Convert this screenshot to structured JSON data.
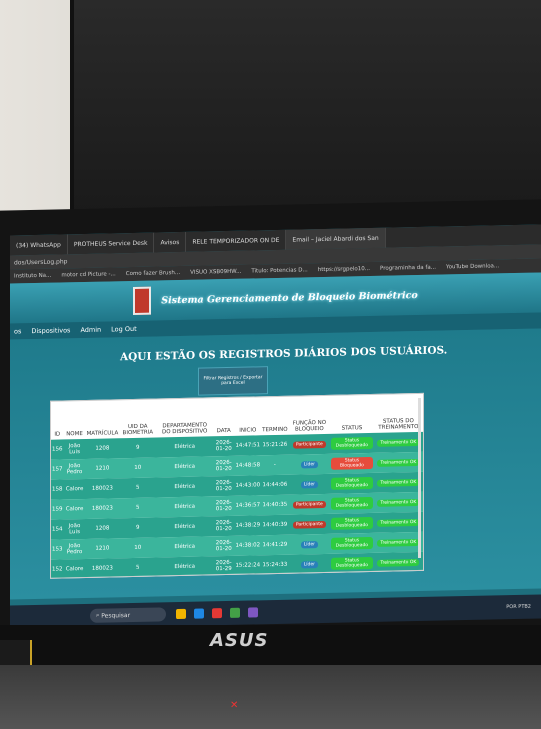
{
  "browser": {
    "tabs": [
      "(34) WhatsApp",
      "PROTHEUS Service Desk",
      "Avisos",
      "RELE TEMPORIZADOR ON DE",
      "Email – Jaciel Abardi dos San"
    ],
    "url": "dos/UsersLog.php",
    "bookmarks": [
      "Instituto Na...",
      "motor cd Picture -...",
      "Como fazer Brush...",
      "VISUO XSB09HW...",
      "Titulo: Potencias D...",
      "https://srgpelo10...",
      "Programinha da fa...",
      "YouTube Downloa..."
    ]
  },
  "app": {
    "title": "Sistema Gerenciamento de Bloqueio Biométrico",
    "nav": [
      "os",
      "Dispositivos",
      "Admin",
      "Log Out"
    ],
    "heading": "AQUI ESTÃO OS REGISTROS DIÁRIOS DOS USUÁRIOS.",
    "filter_button": "Filtrar Registros / Exportar para Excel",
    "columns": [
      "ID",
      "NOME",
      "MATRÍCULA",
      "UID DA BIOMETRIA",
      "DEPARTAMENTO DO DISPOSITIVO",
      "DATA",
      "INICIO",
      "TERMINO",
      "FUNÇÃO NO BLOQUEIO",
      "STATUS",
      "STATUS DO TREINAMENTO"
    ],
    "rows": [
      [
        "156",
        "João Luis",
        "1208",
        "9",
        "Elétrica",
        "2026-01-20",
        "14:47:51",
        "15:21:26",
        "Participante",
        "Status Desbloqueado",
        "Treinamento OK"
      ],
      [
        "157",
        "João Pedro",
        "1210",
        "10",
        "Elétrica",
        "2026-01-20",
        "14:48:58",
        "-",
        "Líder",
        "Status Bloqueado",
        "Treinamento OK"
      ],
      [
        "158",
        "Calore",
        "180023",
        "5",
        "Elétrica",
        "2026-01-20",
        "14:43:00",
        "14:44:06",
        "Líder",
        "Status Desbloqueado",
        "Treinamento OK"
      ],
      [
        "159",
        "Calore",
        "180023",
        "5",
        "Elétrica",
        "2026-01-20",
        "14:36:57",
        "14:40:35",
        "Participante",
        "Status Desbloqueado",
        "Treinamento OK"
      ],
      [
        "154",
        "João Luis",
        "1208",
        "9",
        "Elétrica",
        "2026-01-20",
        "14:38:29",
        "14:40:39",
        "Participante",
        "Status Desbloqueado",
        "Treinamento OK"
      ],
      [
        "153",
        "João Pedro",
        "1210",
        "10",
        "Elétrica",
        "2026-01-20",
        "14:38:02",
        "14:41:29",
        "Líder",
        "Status Desbloqueado",
        "Treinamento OK"
      ],
      [
        "152",
        "Calore",
        "180023",
        "5",
        "Elétrica",
        "2026-01-29",
        "15:22:24",
        "15:24:33",
        "Líder",
        "Status Desbloqueado",
        "Treinamento OK"
      ]
    ]
  },
  "taskbar": {
    "search": "Pesquisar",
    "lang": "POR PTB2"
  },
  "brand": "ASUS",
  "colors": {
    "header": "#1f7688",
    "row": "#2aa38e",
    "status_ok": "#2ecc40",
    "status_blocked": "#e74c3c",
    "participant": "#c0392b",
    "leader": "#2980b9"
  }
}
